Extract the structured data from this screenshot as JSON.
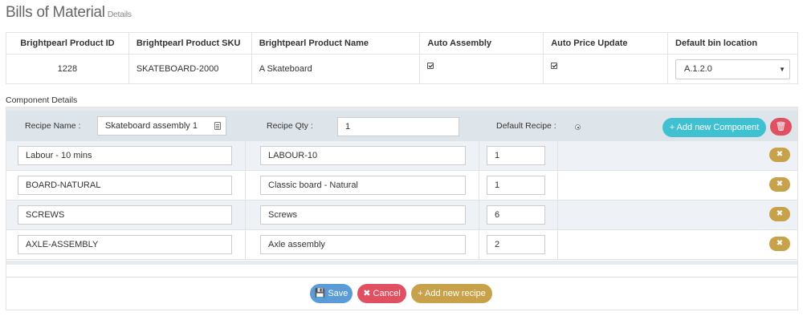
{
  "page": {
    "title": "Bills of Material",
    "subtitle": "Details"
  },
  "product": {
    "headers": [
      "Brightpearl Product ID",
      "Brightpearl Product SKU",
      "Brightpearl Product Name",
      "Auto Assembly",
      "Auto Price Update",
      "Default bin location"
    ],
    "id": "1228",
    "sku": "SKATEBOARD-2000",
    "name": "A Skateboard",
    "auto_assembly": true,
    "auto_price_update": true,
    "bin_location": "A.1.2.0"
  },
  "component_details_label": "Component Details",
  "recipe": {
    "name_label": "Recipe Name :",
    "name_value": "Skateboard assembly 1",
    "qty_label": "Recipe Qty :",
    "qty_value": "1",
    "default_label": "Default Recipe :",
    "add_component_label": "+ Add new Component"
  },
  "components": [
    {
      "sku": "Labour - 10 mins",
      "name": "LABOUR-10",
      "qty": "1"
    },
    {
      "sku": "BOARD-NATURAL",
      "name": "Classic board - Natural",
      "qty": "1"
    },
    {
      "sku": "SCREWS",
      "name": "Screws",
      "qty": "6"
    },
    {
      "sku": "AXLE-ASSEMBLY",
      "name": "Axle assembly",
      "qty": "2"
    }
  ],
  "actions": {
    "save": "Save",
    "cancel": "Cancel",
    "add_recipe": "+ Add new recipe"
  },
  "colors": {
    "teal": "#3fc1d2",
    "red": "#e15061",
    "blue": "#5b9bd8",
    "gold": "#c8a24a"
  }
}
